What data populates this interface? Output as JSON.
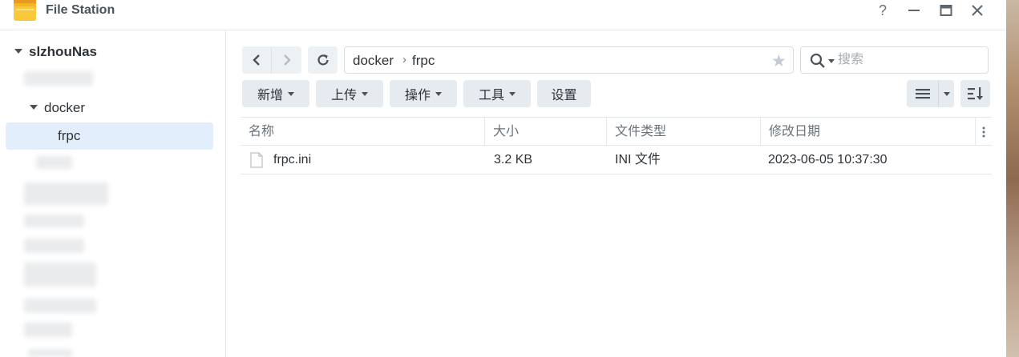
{
  "window": {
    "title": "File Station",
    "help_label": "?"
  },
  "sidebar": {
    "root": "slzhouNas",
    "folders": [
      {
        "label": "docker",
        "expanded": true
      },
      {
        "label": "frpc",
        "selected": true
      }
    ]
  },
  "toolbar": {
    "path": [
      "docker",
      "frpc"
    ],
    "path_separator": "›",
    "search_placeholder": "搜索",
    "buttons": [
      {
        "label": "新增",
        "has_menu": true
      },
      {
        "label": "上传",
        "has_menu": true
      },
      {
        "label": "操作",
        "has_menu": true
      },
      {
        "label": "工具",
        "has_menu": true
      },
      {
        "label": "设置",
        "has_menu": false
      }
    ]
  },
  "table": {
    "columns": [
      "名称",
      "大小",
      "文件类型",
      "修改日期"
    ],
    "rows": [
      {
        "name": "frpc.ini",
        "size": "3.2 KB",
        "type": "INI 文件",
        "modified": "2023-06-05 10:37:30"
      }
    ]
  },
  "colors": {
    "selected_bg": "#e2eefb",
    "button_bg": "#e6ebf0",
    "text": "#2e3338",
    "muted": "#6b737a"
  }
}
